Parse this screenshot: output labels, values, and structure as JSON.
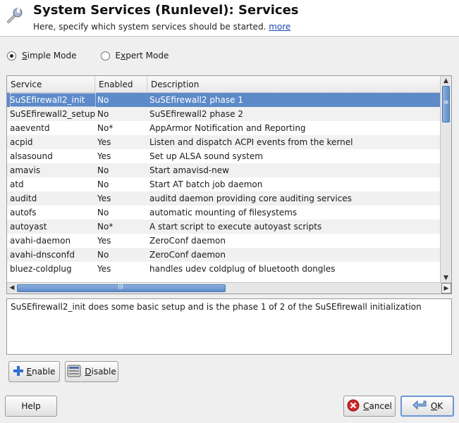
{
  "header": {
    "title": "System Services (Runlevel): Services",
    "subtitle": "Here, specify which system services should be started.",
    "more_link": "more",
    "icon": "wrench-icon"
  },
  "mode": {
    "simple_label_u": "S",
    "simple_label_rest": "imple Mode",
    "expert_label_pre": "E",
    "expert_label_u": "x",
    "expert_label_rest": "pert Mode",
    "selected": "simple"
  },
  "table": {
    "columns": [
      "Service",
      "Enabled",
      "Description"
    ],
    "rows": [
      {
        "service": "SuSEfirewall2_init",
        "enabled": "No",
        "description": "SuSEfirewall2 phase 1"
      },
      {
        "service": "SuSEfirewall2_setup",
        "enabled": "No",
        "description": "SuSEfirewall2 phase 2"
      },
      {
        "service": "aaeventd",
        "enabled": "No*",
        "description": "AppArmor Notification and Reporting"
      },
      {
        "service": "acpid",
        "enabled": "Yes",
        "description": "Listen and dispatch ACPI events from the kernel"
      },
      {
        "service": "alsasound",
        "enabled": "Yes",
        "description": "Set up ALSA sound system"
      },
      {
        "service": "amavis",
        "enabled": "No",
        "description": "Start amavisd-new"
      },
      {
        "service": "atd",
        "enabled": "No",
        "description": "Start AT batch job daemon"
      },
      {
        "service": "auditd",
        "enabled": "Yes",
        "description": "auditd daemon providing core auditing services"
      },
      {
        "service": "autofs",
        "enabled": "No",
        "description": "automatic mounting of filesystems"
      },
      {
        "service": "autoyast",
        "enabled": "No*",
        "description": "A start script to execute autoyast scripts"
      },
      {
        "service": "avahi-daemon",
        "enabled": "Yes",
        "description": "ZeroConf daemon"
      },
      {
        "service": "avahi-dnsconfd",
        "enabled": "No",
        "description": "ZeroConf daemon"
      },
      {
        "service": "bluez-coldplug",
        "enabled": "Yes",
        "description": "handles udev coldplug of bluetooth dongles"
      }
    ],
    "selected_index": 0
  },
  "details": "SuSEfirewall2_init does some basic setup and is the phase 1 of 2 of the SuSEfirewall initialization",
  "buttons": {
    "enable_u": "E",
    "enable_rest": "nable",
    "disable_u": "D",
    "disable_rest": "isable",
    "help": "Help",
    "cancel_u": "C",
    "cancel_rest": "ancel",
    "ok_u": "O",
    "ok_rest": "K"
  },
  "colors": {
    "selection": "#5d8ac8",
    "link": "#1a47b0",
    "cancel_icon": "#d0282a",
    "enable_icon": "#2f6fd0"
  }
}
